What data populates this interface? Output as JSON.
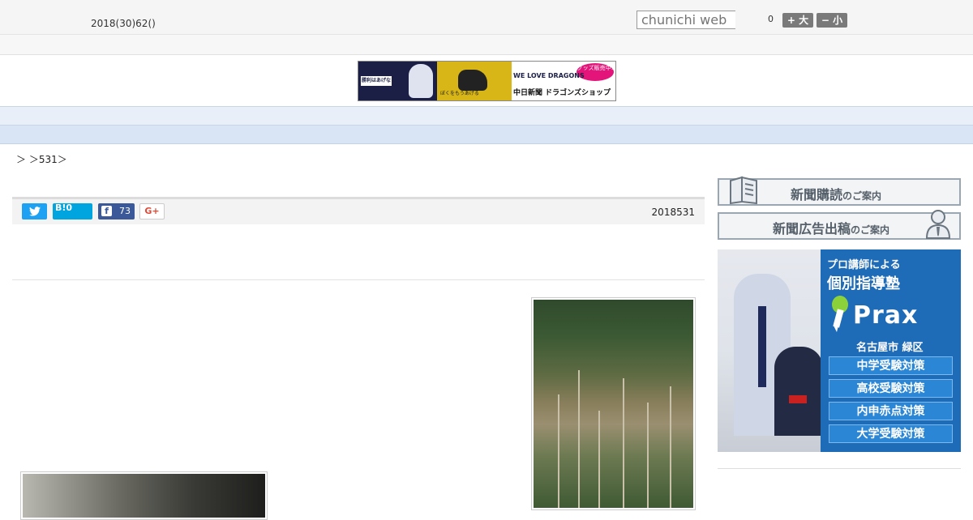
{
  "header": {
    "date": "2018(30)62()",
    "search_placeholder": "chunichi web",
    "font_size_count": "0",
    "font_plus_label": "+ 大",
    "font_minus_label": "− 小"
  },
  "banner": {
    "badge": "勝利はあげない",
    "mid_text": "ぼくをもうあげる",
    "we_love": "WE LOVE DRAGONS",
    "shop": "中日新聞 ドラゴンズショップ",
    "goods": "グッズ販売中!"
  },
  "nav": {
    "items": [
      "",
      "",
      "",
      "",
      "",
      "",
      "",
      "",
      ""
    ]
  },
  "breadcrumb": "＞ ＞531＞",
  "share": {
    "twitter_icon": "twitter-icon",
    "hatena_label": "B!0",
    "facebook_icon_glyph": "f",
    "facebook_count": "73",
    "gplus_label": "G+",
    "published": "2018531"
  },
  "sidebar": {
    "subscribe_label": "新聞購読",
    "subscribe_suffix": "のご案内",
    "ad_label": "新聞広告出稿",
    "ad_suffix": "のご案内"
  },
  "ad": {
    "line1": "プロ講師による",
    "line2": "個別指導塾",
    "logo": "Prax",
    "area": "名古屋市 緑区",
    "pills": [
      "中学受験対策",
      "高校受験対策",
      "内申赤点対策",
      "大学受験対策"
    ]
  },
  "colors": {
    "nav_bg": "#e9eff8",
    "subnav_bg": "#d9e5f4",
    "twitter": "#1da1f2",
    "hatena": "#00a4de",
    "facebook": "#3b5998",
    "ad_blue": "#1e6bb8"
  }
}
